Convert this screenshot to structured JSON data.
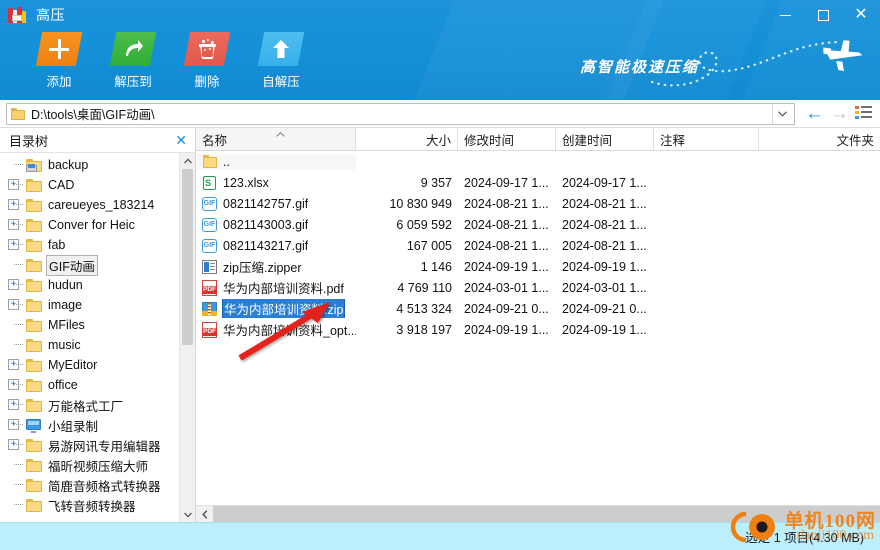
{
  "window": {
    "title": "高压",
    "app_icon": "archive-book-icon",
    "minimize": "–",
    "maximize": "□",
    "close": "✕"
  },
  "header": {
    "slogan": "高智能极速压缩",
    "plane_icon": "airplane-icon",
    "accent_color": "#1591d8"
  },
  "toolbar": {
    "buttons": [
      {
        "label": "添加",
        "icon": "plus-icon",
        "color": "#f07f12"
      },
      {
        "label": "解压到",
        "icon": "extract-arrow-icon",
        "color": "#2fae34"
      },
      {
        "label": "删除",
        "icon": "trash-icon",
        "color": "#e4584b"
      },
      {
        "label": "自解压",
        "icon": "up-arrow-icon",
        "color": "#35b0ea"
      }
    ]
  },
  "address_bar": {
    "path": "D:\\tools\\桌面\\GIF动画\\",
    "folder_icon": "folder-icon",
    "dropdown_icon": "chevron-down-icon",
    "back_icon": "←",
    "forward_icon": "→",
    "view_icon": "list-view-icon"
  },
  "tree": {
    "title": "目录树",
    "close_icon": "✕",
    "items": [
      {
        "label": "backup",
        "icon": "printer-folder-icon",
        "expandable": false,
        "selected": false
      },
      {
        "label": "CAD",
        "icon": "folder-icon",
        "expandable": true,
        "selected": false
      },
      {
        "label": "careueyes_183214",
        "icon": "folder-icon",
        "expandable": true,
        "selected": false
      },
      {
        "label": "Conver for Heic",
        "icon": "folder-icon",
        "expandable": true,
        "selected": false
      },
      {
        "label": "fab",
        "icon": "folder-icon",
        "expandable": true,
        "selected": false
      },
      {
        "label": "GIF动画",
        "icon": "folder-icon",
        "expandable": false,
        "selected": true
      },
      {
        "label": "hudun",
        "icon": "folder-icon",
        "expandable": true,
        "selected": false
      },
      {
        "label": "image",
        "icon": "folder-icon",
        "expandable": true,
        "selected": false
      },
      {
        "label": "MFiles",
        "icon": "folder-icon",
        "expandable": false,
        "selected": false
      },
      {
        "label": "music",
        "icon": "folder-icon",
        "expandable": false,
        "selected": false
      },
      {
        "label": "MyEditor",
        "icon": "folder-icon",
        "expandable": true,
        "selected": false
      },
      {
        "label": "office",
        "icon": "folder-icon",
        "expandable": true,
        "selected": false
      },
      {
        "label": "万能格式工厂",
        "icon": "folder-icon",
        "expandable": true,
        "selected": false
      },
      {
        "label": "小组录制",
        "icon": "monitor-icon",
        "expandable": true,
        "selected": false
      },
      {
        "label": "易游网讯专用编辑器",
        "icon": "folder-icon",
        "expandable": true,
        "selected": false
      },
      {
        "label": "福昕视频压缩大师",
        "icon": "folder-icon",
        "expandable": false,
        "selected": false
      },
      {
        "label": "简鹿音频格式转换器",
        "icon": "folder-icon",
        "expandable": false,
        "selected": false
      },
      {
        "label": "飞转音频转换器",
        "icon": "folder-icon",
        "expandable": false,
        "selected": false
      }
    ],
    "scroll_up_icon": "⌃",
    "scroll_down_icon": "⌄"
  },
  "file_list": {
    "columns": [
      {
        "key": "name",
        "label": "名称",
        "sorted": true,
        "sort_icon": "⌃"
      },
      {
        "key": "size",
        "label": "大小"
      },
      {
        "key": "mod",
        "label": "修改时间"
      },
      {
        "key": "crt",
        "label": "创建时间"
      },
      {
        "key": "cmt",
        "label": "注释"
      },
      {
        "key": "fld",
        "label": "文件夹"
      }
    ],
    "rows": [
      {
        "name": "..",
        "icon": "folder-icon",
        "size": "",
        "mod": "",
        "crt": "",
        "cmt": "",
        "selected": false,
        "updir": true
      },
      {
        "name": "123.xlsx",
        "icon": "xlsx-icon",
        "size": "9 357",
        "mod": "2024-09-17 1...",
        "crt": "2024-09-17 1...",
        "cmt": "",
        "selected": false
      },
      {
        "name": "0821142757.gif",
        "icon": "gif-icon",
        "size": "10 830 949",
        "mod": "2024-08-21 1...",
        "crt": "2024-08-21 1...",
        "cmt": "",
        "selected": false
      },
      {
        "name": "0821143003.gif",
        "icon": "gif-icon",
        "size": "6 059 592",
        "mod": "2024-08-21 1...",
        "crt": "2024-08-21 1...",
        "cmt": "",
        "selected": false
      },
      {
        "name": "0821143217.gif",
        "icon": "gif-icon",
        "size": "167 005",
        "mod": "2024-08-21 1...",
        "crt": "2024-08-21 1...",
        "cmt": "",
        "selected": false
      },
      {
        "name": "zip压缩.zipper",
        "icon": "doc-icon",
        "size": "1 146",
        "mod": "2024-09-19 1...",
        "crt": "2024-09-19 1...",
        "cmt": "",
        "selected": false
      },
      {
        "name": "华为内部培训资料.pdf",
        "icon": "pdf-icon",
        "size": "4 769 110",
        "mod": "2024-03-01 1...",
        "crt": "2024-03-01 1...",
        "cmt": "",
        "selected": false
      },
      {
        "name": "华为内部培训资料.zip",
        "icon": "zip-icon",
        "size": "4 513 324",
        "mod": "2024-09-21 0...",
        "crt": "2024-09-21 0...",
        "cmt": "",
        "selected": true
      },
      {
        "name": "华为内部培训资料_opt....",
        "icon": "pdf-icon",
        "size": "3 918 197",
        "mod": "2024-09-19 1...",
        "crt": "2024-09-19 1...",
        "cmt": "",
        "selected": false
      }
    ],
    "hscroll_left_icon": "‹"
  },
  "status_bar": {
    "text": "选定 1 项目(4.30 MB)"
  },
  "watermark": {
    "line1": "单机100网",
    "line2": "danji100.com",
    "logo_text": "选定",
    "color": "#f07f12"
  },
  "annotation": {
    "arrow": "red-pointer-arrow",
    "color": "#e4231c"
  }
}
